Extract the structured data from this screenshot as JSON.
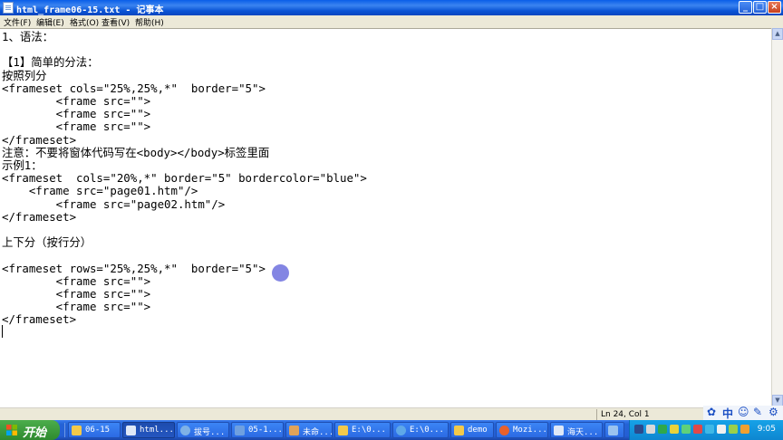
{
  "window": {
    "title": "html_frame06-15.txt - 记事本",
    "min_glyph": "_",
    "max_glyph": "□",
    "close_glyph": "×"
  },
  "menu": [
    "文件(F)",
    "编辑(E)",
    "格式(O)",
    "查看(V)",
    "帮助(H)"
  ],
  "editor": {
    "content": "1、语法：\n\n【1】简单的分法：\n按照列分\n<frameset cols=\"25%,25%,*\"  border=\"5\">\n        <frame src=\"\">\n        <frame src=\"\">\n        <frame src=\"\">\n</frameset>\n注意：不要将窗体代码写在<body></body>标签里面\n示例1：\n<frameset  cols=\"20%,*\" border=\"5\" bordercolor=\"blue\">\n    <frame src=\"page01.htm\"/>\n        <frame src=\"page02.htm\"/>\n</frameset>\n\n上下分（按行分）\n\n<frameset rows=\"25%,25%,*\"  border=\"5\">\n        <frame src=\"\">\n        <frame src=\"\">\n        <frame src=\"\">\n</frameset>\n"
  },
  "status": {
    "position": "Ln 24, Col 1"
  },
  "langbar": [
    "中"
  ],
  "taskbar": {
    "start": "开始",
    "tasks": [
      "06-15",
      "html...",
      "拔号...",
      "05-1...",
      "未命...",
      "E:\\0...",
      "E:\\0...",
      "demo",
      "Mozi...",
      "海天..."
    ],
    "clock": "9:05"
  },
  "colors": {
    "titlebar": "#0a5ee8",
    "taskbar": "#245ed4",
    "start": "#3c9a3c",
    "pointer": "#7678e0"
  }
}
